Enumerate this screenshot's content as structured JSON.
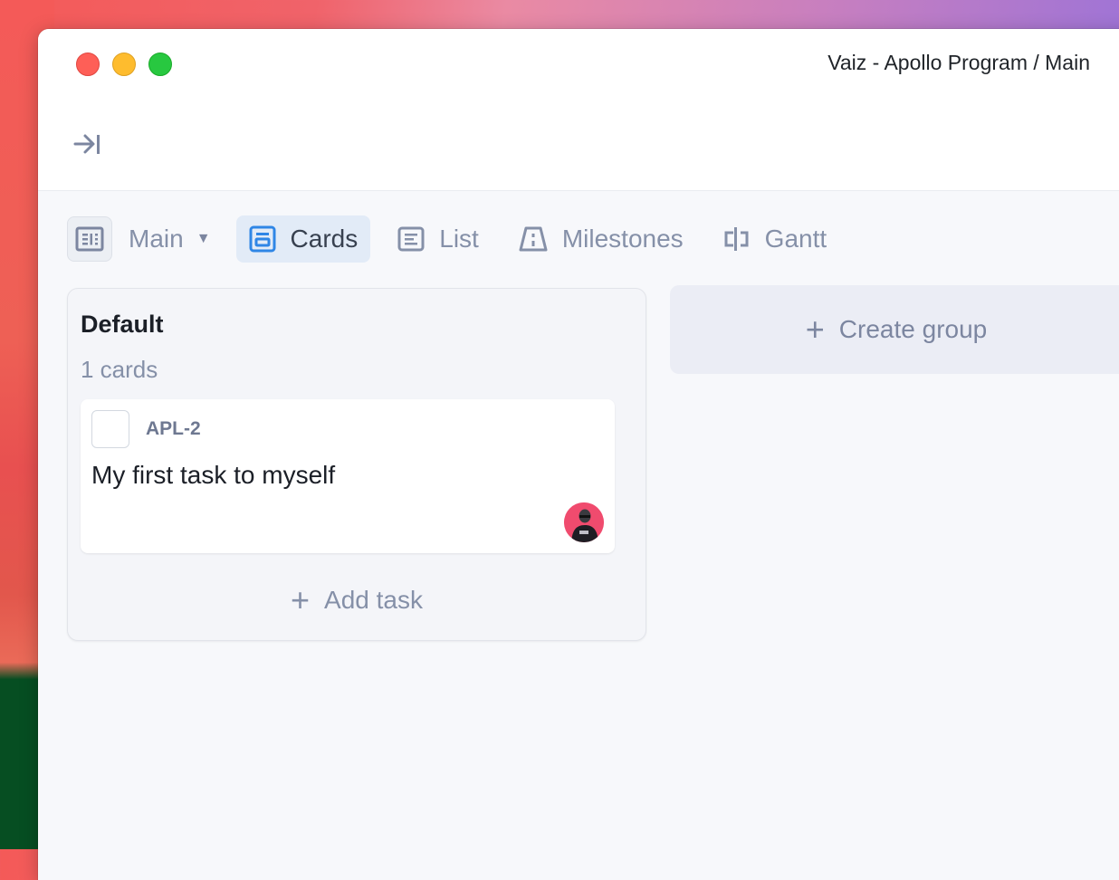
{
  "window": {
    "title": "Vaiz - Apollo Program / Main"
  },
  "toolbar": {
    "sidebar_toggle_icon": "collapse-sidebar-icon",
    "view_selector": {
      "icon": "board-view-icon",
      "label": "Main",
      "caret": "▼"
    },
    "tabs": [
      {
        "label": "Cards",
        "icon": "cards-icon",
        "active": true
      },
      {
        "label": "List",
        "icon": "list-icon",
        "active": false
      },
      {
        "label": "Milestones",
        "icon": "road-icon",
        "active": false
      },
      {
        "label": "Gantt",
        "icon": "gantt-icon",
        "active": false
      }
    ]
  },
  "board": {
    "groups": [
      {
        "title": "Default",
        "count_label": "1 cards",
        "cards": [
          {
            "id": "APL-2",
            "title": "My first task to myself",
            "assignee_avatar": "user-avatar"
          }
        ],
        "add_task_label": "Add task"
      }
    ],
    "create_group_label": "Create group"
  },
  "colors": {
    "accent": "#2f86e6",
    "active_tab_bg": "#e2ebf7",
    "muted_text": "#8590a8"
  }
}
